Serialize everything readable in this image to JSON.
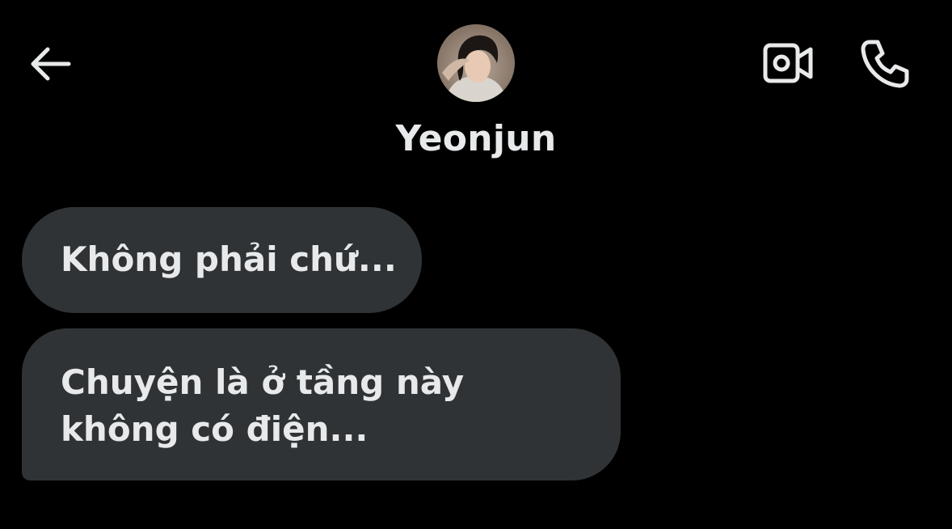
{
  "header": {
    "back_icon": "arrow-left-icon",
    "contact_name": "Yeonjun",
    "avatar_icon": "profile-photo",
    "video_icon": "video-camera-icon",
    "call_icon": "phone-icon"
  },
  "messages": [
    {
      "text": "Không phải chứ..."
    },
    {
      "text": "Chuyện là ở tầng này không có điện..."
    }
  ],
  "colors": {
    "background": "#000000",
    "bubble": "#2f3336",
    "text": "#e7e9ea"
  }
}
